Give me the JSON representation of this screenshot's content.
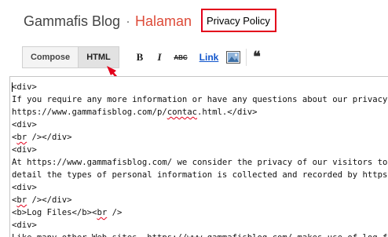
{
  "header": {
    "blog_name": "Gammafis Blog",
    "separator": "·",
    "page_type": "Halaman",
    "title_value": "Privacy Policy"
  },
  "toolbar": {
    "compose_label": "Compose",
    "html_label": "HTML",
    "bold_label": "B",
    "italic_label": "I",
    "strike_label": "ABC",
    "link_label": "Link",
    "image_icon": "image-icon",
    "quote_label": "❝"
  },
  "colors": {
    "page_type": "#dd4b39",
    "annotation": "#e3001b",
    "link": "#1155cc"
  },
  "editor": {
    "lines": [
      "<div>",
      "If you require any more information or have any questions about our privacy policy, please feel free to contact us by email at",
      [
        "https://www.gammafisblog.com/p/",
        "contac",
        ".html",
        ".</div>"
      ],
      "<div>",
      [
        "<",
        "br",
        " /></div>"
      ],
      "<div>",
      "At https://www.gammafisblog.com/ we consider the privacy of our visitors to be extremely important. This privacy policy document describes in",
      "detail the types of personal information is collected and recorded by https://www.gammafisblog.com/ and how we use it.",
      "<div>",
      [
        "<",
        "br",
        " /></div>"
      ],
      [
        "<b>Log Files</b><",
        "br",
        " />"
      ],
      "<div>",
      "Like many other Web sites, https://www.gammafisblog.com/ makes use of log files."
    ]
  }
}
